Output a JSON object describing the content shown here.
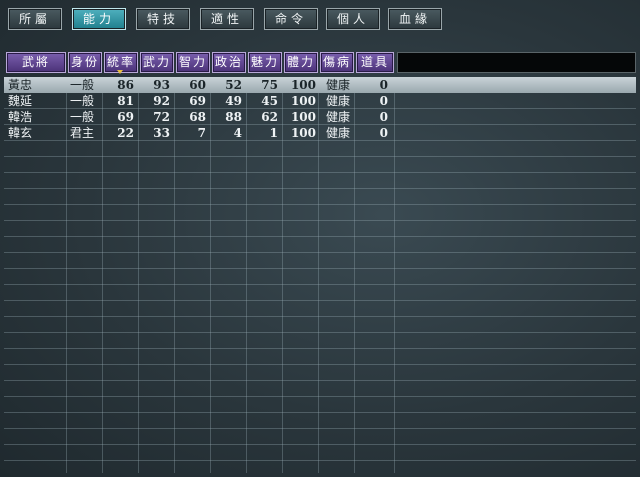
{
  "tabs": [
    {
      "label": "所屬",
      "active": false
    },
    {
      "label": "能力",
      "active": true
    },
    {
      "label": "特技",
      "active": false
    },
    {
      "label": "適性",
      "active": false
    },
    {
      "label": "命令",
      "active": false
    },
    {
      "label": "個人",
      "active": false
    },
    {
      "label": "血緣",
      "active": false
    }
  ],
  "headers": [
    "武將",
    "身份",
    "統率",
    "武力",
    "智力",
    "政治",
    "魅力",
    "體力",
    "傷病",
    "道具"
  ],
  "sort_column": "統率",
  "rows": [
    {
      "name": "黃忠",
      "rank": "一般",
      "lead": "86",
      "war": "93",
      "int": "60",
      "pol": "52",
      "chr": "75",
      "hp": "100",
      "health": "健康",
      "item": "0",
      "selected": true
    },
    {
      "name": "魏延",
      "rank": "一般",
      "lead": "81",
      "war": "92",
      "int": "69",
      "pol": "49",
      "chr": "45",
      "hp": "100",
      "health": "健康",
      "item": "0",
      "selected": false
    },
    {
      "name": "韓浩",
      "rank": "一般",
      "lead": "69",
      "war": "72",
      "int": "68",
      "pol": "88",
      "chr": "62",
      "hp": "100",
      "health": "健康",
      "item": "0",
      "selected": false
    },
    {
      "name": "韓玄",
      "rank": "君主",
      "lead": "22",
      "war": "33",
      "int": "7",
      "pol": "4",
      "chr": "1",
      "hp": "100",
      "health": "健康",
      "item": "0",
      "selected": false
    }
  ],
  "colors": {
    "active_tab": "#1f7f8d",
    "header": "#5a3f8c",
    "selected_row": "#b3bec4"
  }
}
